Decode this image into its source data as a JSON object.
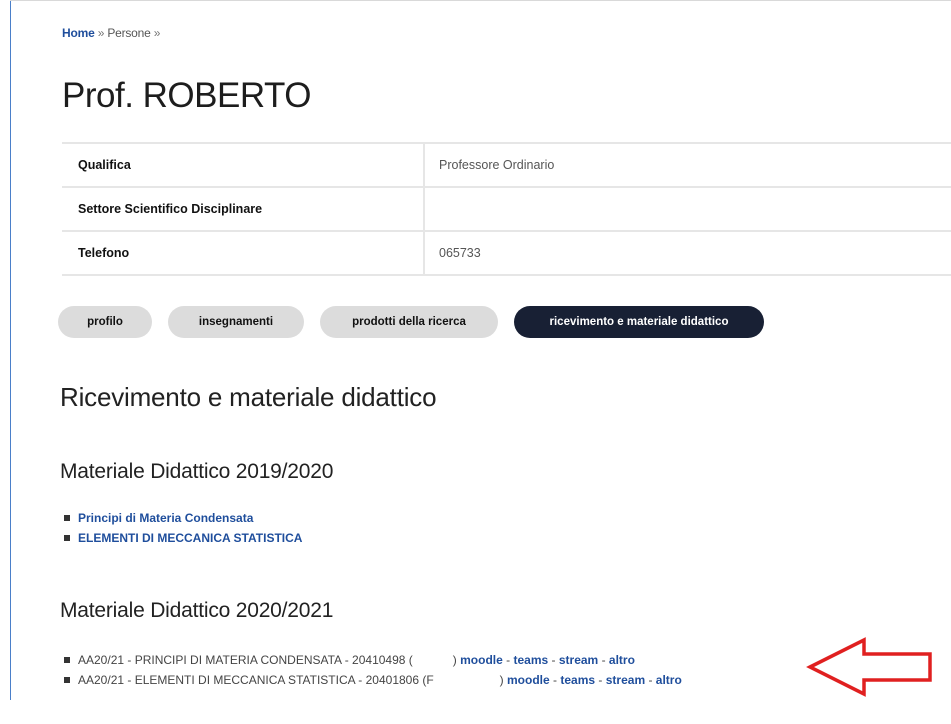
{
  "breadcrumb": {
    "home": "Home",
    "sep1": "»",
    "current": "Persone",
    "sep2": "»"
  },
  "title": "Prof. ROBERTO",
  "info": [
    {
      "key": "Qualifica",
      "value": "Professore Ordinario"
    },
    {
      "key": "Settore Scientifico Disciplinare",
      "value": ""
    },
    {
      "key": "Telefono",
      "value": "065733"
    }
  ],
  "tabs": [
    {
      "label": "profilo",
      "active": false
    },
    {
      "label": "insegnamenti",
      "active": false
    },
    {
      "label": "prodotti della ricerca",
      "active": false
    },
    {
      "label": "ricevimento e materiale didattico",
      "active": true
    }
  ],
  "section_title": "Ricevimento e materiale didattico",
  "materiale_2019": {
    "title": "Materiale Didattico 2019/2020",
    "items": [
      "Principi di Materia Condensata",
      "ELEMENTI DI MECCANICA STATISTICA"
    ]
  },
  "materiale_2020": {
    "title": "Materiale Didattico 2020/2021",
    "items": [
      {
        "text": "AA20/21 - PRINCIPI DI MATERIA CONDENSATA - 20410498 (",
        "close": ")",
        "links": [
          "moodle",
          "teams",
          "stream",
          "altro"
        ],
        "sep": "-"
      },
      {
        "text": "AA20/21 - ELEMENTI DI MECCANICA STATISTICA - 20401806 (F",
        "close": ")",
        "links": [
          "moodle",
          "teams",
          "stream",
          "altro"
        ],
        "sep": "-"
      }
    ]
  },
  "colors": {
    "link": "#1f4e9c",
    "tab_active_bg": "#182034",
    "tab_bg": "#dcdcdc",
    "arrow": "#e02020",
    "frame": "#4a7fc9"
  },
  "icons": {
    "arrow": "arrow-left-outline-icon"
  }
}
